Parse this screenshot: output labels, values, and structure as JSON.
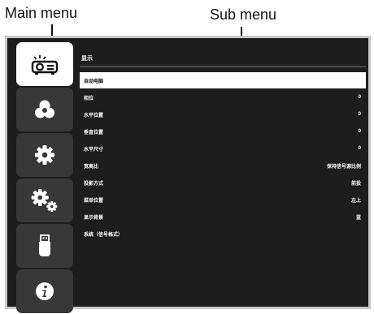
{
  "callouts": {
    "main_menu": "Main menu",
    "sub_menu": "Sub menu"
  },
  "sidebar": {
    "items": [
      {
        "icon": "projector-icon",
        "active": true
      },
      {
        "icon": "color-circles-icon",
        "active": false
      },
      {
        "icon": "gear-icon",
        "active": false
      },
      {
        "icon": "gears-icon",
        "active": false
      },
      {
        "icon": "usb-drive-icon",
        "active": false
      },
      {
        "icon": "info-icon",
        "active": false
      }
    ]
  },
  "submenu": {
    "title": "显示",
    "rows": [
      {
        "label": "自动电脑",
        "value": "",
        "selected": true
      },
      {
        "label": "相位",
        "value": "0"
      },
      {
        "label": "水平位置",
        "value": "0"
      },
      {
        "label": "垂直位置",
        "value": "0"
      },
      {
        "label": "水平尺寸",
        "value": "0"
      },
      {
        "label": "宽高比",
        "value": "保持信号源比例"
      },
      {
        "label": "投影方式",
        "value": "前投"
      },
      {
        "label": "菜单位置",
        "value": "左上"
      },
      {
        "label": "显示背景",
        "value": "蓝"
      },
      {
        "label": "系统（信号格式）",
        "value": ""
      }
    ]
  },
  "colors": {
    "screen_bg": "#1d1d1d",
    "tile_bg": "#383838",
    "active_bg": "#ffffff",
    "text": "#ffffff"
  }
}
